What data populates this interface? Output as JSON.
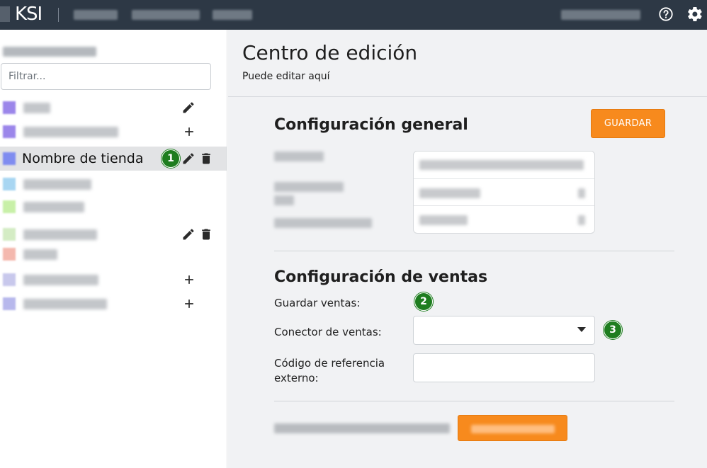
{
  "header": {
    "logo_text": "KSI",
    "brand_color": "#2d3845",
    "icons": [
      "help-icon",
      "gear-icon"
    ]
  },
  "sidebar": {
    "filter_placeholder": "Filtrar...",
    "items": [
      {
        "label": "",
        "color": "#9b86ea",
        "actions": [
          "edit-icon"
        ]
      },
      {
        "label": "",
        "color": "#9b86ea",
        "actions": [
          "add-icon"
        ]
      },
      {
        "label": "Nombre de tienda",
        "color": "#7f8cf0",
        "selected": true,
        "actions": [
          "edit-icon",
          "delete-icon"
        ]
      },
      {
        "label": "",
        "color": "#a8d6f2",
        "actions": []
      },
      {
        "label": "",
        "color": "#c8f0a8",
        "actions": []
      },
      {
        "label": "",
        "color": "#d4ecc4",
        "actions": [
          "edit-icon",
          "delete-icon"
        ]
      },
      {
        "label": "",
        "color": "#f4b8ae",
        "actions": []
      },
      {
        "label": "",
        "color": "#c8c8ec",
        "actions": [
          "add-icon"
        ]
      },
      {
        "label": "",
        "color": "#b7b8ec",
        "actions": [
          "add-icon"
        ]
      }
    ]
  },
  "main": {
    "title": "Centro de edición",
    "subtitle": "Puede editar aquí",
    "general": {
      "title": "Configuración general",
      "save_label": "GUARDAR",
      "accent": "#f78a1d"
    },
    "sales": {
      "title": "Configuración de ventas",
      "save_sales_label": "Guardar ventas:",
      "connector_label": "Conector de ventas:",
      "connector_value": "",
      "reference_label": "Código de referencia externo:",
      "reference_value": ""
    }
  },
  "badges": [
    "1",
    "2",
    "3"
  ]
}
